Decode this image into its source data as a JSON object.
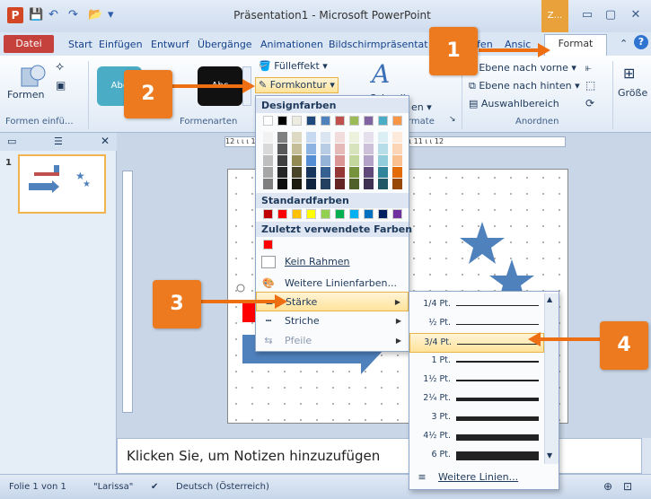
{
  "titlebar": {
    "app_glyph": "P",
    "quick_access": [
      "💾",
      "↶",
      "↷",
      "📂",
      "▾"
    ],
    "title": "Präsentation1 - Microsoft PowerPoint",
    "context_group": "Z...",
    "controls": [
      "▭",
      "▢",
      "✕"
    ]
  },
  "tabs": [
    {
      "label": "Datei"
    },
    {
      "label": "Start"
    },
    {
      "label": "Einfügen"
    },
    {
      "label": "Entwurf"
    },
    {
      "label": "Übergänge"
    },
    {
      "label": "Animationen"
    },
    {
      "label": "Bildschirmpräsentat"
    },
    {
      "label": "ifen"
    },
    {
      "label": "Ansic"
    },
    {
      "label": "Format"
    }
  ],
  "ribbon": {
    "formen_label": "Formen",
    "formen_group": "Formen einfü...",
    "style_tile_text": "Abc",
    "fuelleffekt": "Fülleffekt ▾",
    "formkontur": "Formkontur ▾",
    "formenarten_group": "Formenarten",
    "schnell": "Schnell",
    "format_partial": "rmate",
    "text_partial": "en ▾",
    "ebene_vorne": "Ebene nach vorne ▾",
    "ebene_hinten": "Ebene nach hinten ▾",
    "auswahlbereich": "Auswahlbereich",
    "anordnen_group": "Anordnen",
    "groesse": "Größe"
  },
  "color_menu": {
    "design_header": "Designfarben",
    "standard_header": "Standardfarben",
    "recent_header": "Zuletzt verwendete Farben",
    "theme_top": [
      "#ffffff",
      "#000000",
      "#eeece1",
      "#1f497d",
      "#4f81bd",
      "#c0504d",
      "#9bbb59",
      "#8064a2",
      "#4bacc6",
      "#f79646"
    ],
    "theme_shades": [
      [
        "#f2f2f2",
        "#d9d9d9",
        "#bfbfbf",
        "#a6a6a6",
        "#7f7f7f"
      ],
      [
        "#7f7f7f",
        "#595959",
        "#404040",
        "#262626",
        "#0d0d0d"
      ],
      [
        "#ddd9c3",
        "#c4bd97",
        "#938953",
        "#494429",
        "#1d1b10"
      ],
      [
        "#c6d9f0",
        "#8db3e2",
        "#548dd4",
        "#17365d",
        "#0f243e"
      ],
      [
        "#dbe5f1",
        "#b8cce4",
        "#95b3d7",
        "#366092",
        "#244061"
      ],
      [
        "#f2dcdb",
        "#e5b9b7",
        "#d99694",
        "#953734",
        "#632423"
      ],
      [
        "#ebf1dd",
        "#d7e3bc",
        "#c3d69b",
        "#76923c",
        "#4f6128"
      ],
      [
        "#e5e0ec",
        "#ccc1d9",
        "#b2a2c7",
        "#5f497a",
        "#3f3151"
      ],
      [
        "#dbeef3",
        "#b7dde8",
        "#92cddc",
        "#31859b",
        "#205867"
      ],
      [
        "#fdeada",
        "#fbd5b5",
        "#fac08f",
        "#e36c09",
        "#974806"
      ]
    ],
    "standard": [
      "#c00000",
      "#ff0000",
      "#ffc000",
      "#ffff00",
      "#92d050",
      "#00b050",
      "#00b0f0",
      "#0070c0",
      "#002060",
      "#7030a0"
    ],
    "recent": [
      "#ff0000"
    ],
    "kein_rahmen": "Kein Rahmen",
    "weitere_linienfarben": "Weitere Linienfarben...",
    "staerke": "Stärke",
    "striche": "Striche",
    "pfeile": "Pfeile"
  },
  "weight_menu": {
    "items": [
      {
        "label": "1/4 Pt.",
        "pt": 0.25
      },
      {
        "label": "½ Pt.",
        "pt": 0.5
      },
      {
        "label": "3/4 Pt.",
        "pt": 0.75
      },
      {
        "label": "1 Pt.",
        "pt": 1
      },
      {
        "label": "1½ Pt.",
        "pt": 1.5
      },
      {
        "label": "2¼ Pt.",
        "pt": 2.25
      },
      {
        "label": "3 Pt.",
        "pt": 3
      },
      {
        "label": "4½ Pt.",
        "pt": 4.5
      },
      {
        "label": "6 Pt.",
        "pt": 6
      }
    ],
    "selected_index": 2,
    "weitere_linien": "Weitere Linien..."
  },
  "ruler_text": "12 ι ι ι 1 ι ι 2 ι ι 3 ι 4 ι ι 5 ι ι 6 ι ι 7 ι ι 8 ι ι 9 ι ι 10 ι ι 11 ι ι 12",
  "notes": "Klicken Sie, um Notizen hinzuzufügen",
  "status": {
    "folie": "Folie 1 von 1",
    "design": "\"Larissa\"",
    "sprache": "Deutsch (Österreich)"
  },
  "callouts": [
    "1",
    "2",
    "3",
    "4"
  ],
  "colors": {
    "accent_orange": "#ee7a1f",
    "shape_blue": "#4f81bd",
    "datei_red": "#c4413c"
  }
}
